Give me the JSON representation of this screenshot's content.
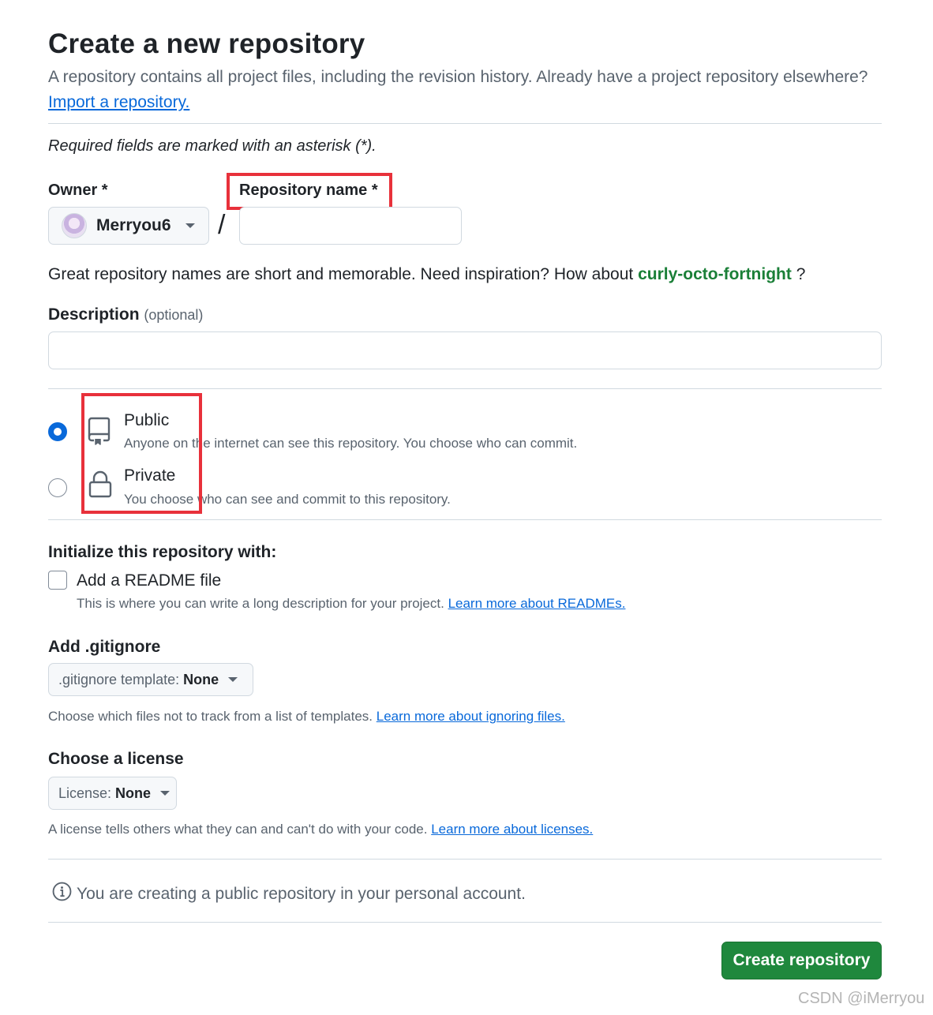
{
  "page": {
    "title": "Create a new repository",
    "subtitle": "A repository contains all project files, including the revision history. Already have a project repository elsewhere?",
    "import_link": "Import a repository.",
    "required_note": "Required fields are marked with an asterisk (*)."
  },
  "owner": {
    "label": "Owner *",
    "name": "Merryou6"
  },
  "repo_name": {
    "label": "Repository name *",
    "value": "",
    "placeholder": ""
  },
  "separator": "/",
  "name_hint": {
    "text": "Great repository names are short and memorable. Need inspiration? How about",
    "suggestion": "curly-octo-fortnight",
    "suffix": "?"
  },
  "description": {
    "label": "Description",
    "optional": "(optional)",
    "value": ""
  },
  "visibility": {
    "selected": "public",
    "options": [
      {
        "id": "public",
        "title": "Public",
        "desc": "Anyone on the internet can see this repository. You choose who can commit.",
        "icon": "repo-book-icon"
      },
      {
        "id": "private",
        "title": "Private",
        "desc": "You choose who can see and commit to this repository.",
        "icon": "lock-icon"
      }
    ]
  },
  "initialize": {
    "title": "Initialize this repository with:",
    "readme_label": "Add a README file",
    "readme_checked": false,
    "readme_note": "This is where you can write a long description for your project.",
    "readme_link": "Learn more about READMEs."
  },
  "gitignore": {
    "title": "Add .gitignore",
    "select_prefix": ".gitignore template:",
    "select_value": "None",
    "note": "Choose which files not to track from a list of templates.",
    "link": "Learn more about ignoring files."
  },
  "license": {
    "title": "Choose a license",
    "select_prefix": "License:",
    "select_value": "None",
    "note": "A license tells others what they can and can't do with your code.",
    "link": "Learn more about licenses."
  },
  "info": {
    "text": "You are creating a public repository in your personal account.",
    "icon": "info-icon"
  },
  "actions": {
    "create_label": "Create repository"
  },
  "watermark": "CSDN @iMerryou",
  "colors": {
    "accent_blue": "#0969da",
    "primary_green": "#1f883d",
    "suggestion_green": "#1a7f37",
    "highlight_red": "#e8313b",
    "muted_text": "#59636e",
    "border": "#d1d9e0"
  }
}
